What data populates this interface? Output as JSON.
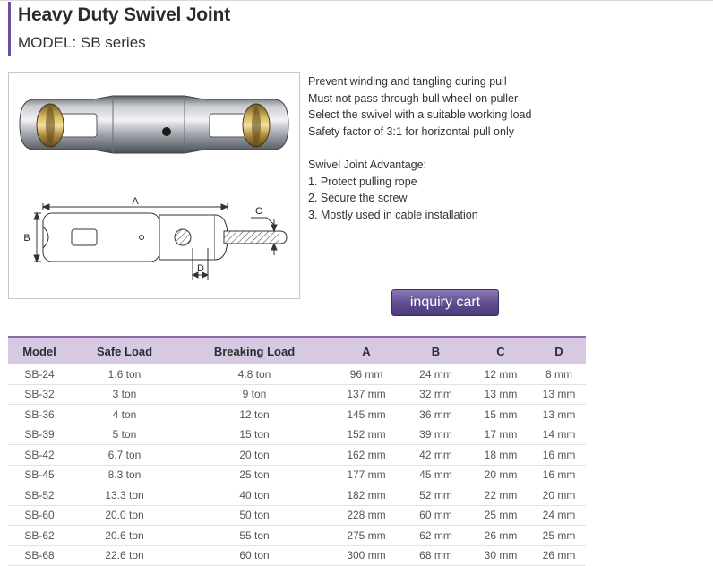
{
  "header": {
    "title": "Heavy Duty Swivel Joint",
    "model": "MODEL: SB series"
  },
  "diagram": {
    "label_a": "A",
    "label_b": "B",
    "label_c": "C",
    "label_d": "D"
  },
  "features": [
    "Prevent winding and tangling during pull",
    "Must not pass through bull wheel on puller",
    "Select the swivel with a suitable working load",
    "Safety factor of 3:1 for horizontal pull only"
  ],
  "advantage": {
    "title": "Swivel Joint Advantage:",
    "items": [
      "1. Protect pulling rope",
      "2. Secure the screw",
      "3. Mostly used in cable installation"
    ]
  },
  "cart": {
    "label": "inquiry cart"
  },
  "colors": {
    "accent": "#6d4ea0",
    "table_header": "#d8c9e2",
    "button": "#5f4b8f"
  },
  "table": {
    "headers": [
      "Model",
      "Safe Load",
      "Breaking Load",
      "A",
      "B",
      "C",
      "D"
    ],
    "rows": [
      [
        "SB-24",
        "1.6 ton",
        "4.8 ton",
        "96 mm",
        "24 mm",
        "12 mm",
        "8 mm"
      ],
      [
        "SB-32",
        "3 ton",
        "9 ton",
        "137 mm",
        "32 mm",
        "13 mm",
        "13 mm"
      ],
      [
        "SB-36",
        "4 ton",
        "12 ton",
        "145 mm",
        "36 mm",
        "15 mm",
        "13 mm"
      ],
      [
        "SB-39",
        "5 ton",
        "15 ton",
        "152 mm",
        "39 mm",
        "17 mm",
        "14 mm"
      ],
      [
        "SB-42",
        "6.7 ton",
        "20 ton",
        "162 mm",
        "42 mm",
        "18 mm",
        "16 mm"
      ],
      [
        "SB-45",
        "8.3 ton",
        "25 ton",
        "177 mm",
        "45 mm",
        "20 mm",
        "16 mm"
      ],
      [
        "SB-52",
        "13.3 ton",
        "40 ton",
        "182 mm",
        "52 mm",
        "22 mm",
        "20 mm"
      ],
      [
        "SB-60",
        "20.0 ton",
        "50 ton",
        "228 mm",
        "60 mm",
        "25 mm",
        "24 mm"
      ],
      [
        "SB-62",
        "20.6 ton",
        "55 ton",
        "275 mm",
        "62 mm",
        "26 mm",
        "25 mm"
      ],
      [
        "SB-68",
        "22.6 ton",
        "60 ton",
        "300 mm",
        "68 mm",
        "30 mm",
        "26 mm"
      ]
    ]
  }
}
